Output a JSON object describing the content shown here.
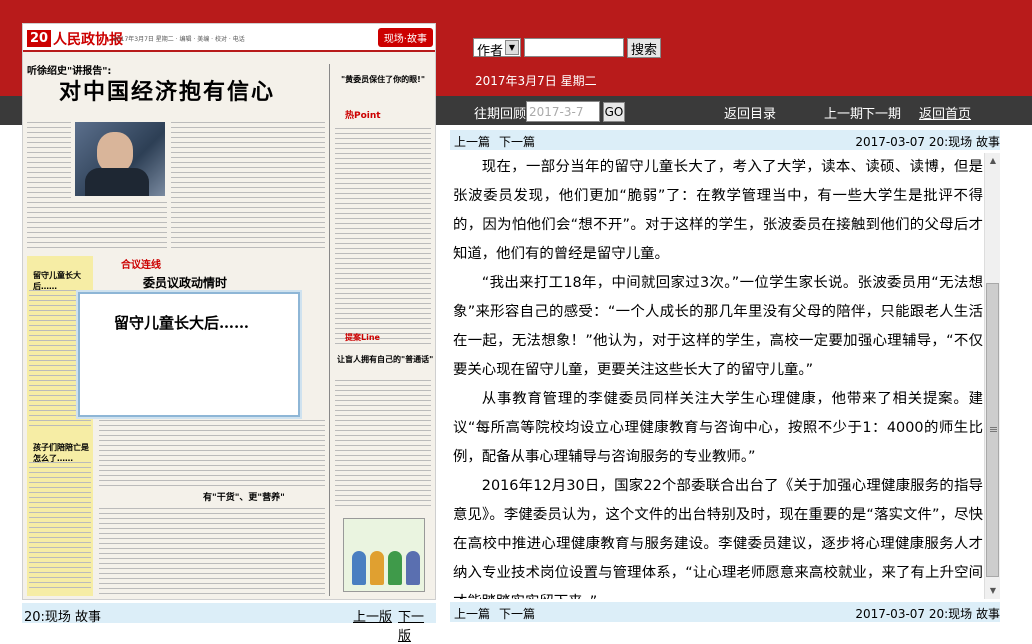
{
  "newspaper": {
    "page_number": "20",
    "masthead": "人民政协报",
    "header_small": "2017年3月7日 星期二 · 编辑 · 美编 · 校对 · 电话",
    "section_badge": "现场·故事",
    "kicker": "听徐绍史\"讲报告\":",
    "headline": "对中国经济抱有信心",
    "right_title": "\"黄委员保住了你的眼!\"",
    "right_logo": "热Point",
    "yellow_label_1": "留守儿童长大后……",
    "yellow_label_2": "孩子们陪陪亡是怎么了……",
    "heyi_label": "合议连线",
    "heyi_title": "委员议政动情时",
    "right_title_3": "让盲人拥有自己的\"普通话\"",
    "right_badge": "提案Line",
    "bottom_title": "有\"干货\"、更\"营养\""
  },
  "popup": {
    "text": "留守儿童长大后……"
  },
  "left_footer": {
    "page_label": "20:现场 故事",
    "prev_edition": "上一版",
    "next_edition": "下一版"
  },
  "search": {
    "field_selected": "作者",
    "placeholder": "",
    "button": "搜索"
  },
  "date_line": "2017年3月7日 星期二",
  "nav": {
    "back_issue_label": "往期回顾:",
    "date_value": "2017-3-7",
    "go": "GO",
    "back_to_index": "返回目录",
    "prev_issue": "上一期",
    "next_issue": "下一期",
    "home": "返回首页"
  },
  "article_nav": {
    "prev": "上一篇",
    "next": "下一篇",
    "meta": "2017-03-07 20:现场 故事"
  },
  "article": {
    "paragraphs": [
      "现在，一部分当年的留守儿童长大了，考入了大学，读本、读硕、读博，但是张波委员发现，他们更加“脆弱”了：在教学管理当中，有一些大学生是批评不得的，因为怕他们会“想不开”。对于这样的学生，张波委员在接触到他们的父母后才知道，他们有的曾经是留守儿童。",
      "“我出来打工18年，中间就回家过3次。”一位学生家长说。张波委员用“无法想象”来形容自己的感受：“一个人成长的那几年里没有父母的陪伴，只能跟老人生活在一起，无法想象！”他认为，对于这样的学生，高校一定要加强心理辅导，“不仅要关心现在留守儿童，更要关注这些长大了的留守儿童。”",
      "从事教育管理的李健委员同样关注大学生心理健康，他带来了相关提案。建议“每所高等院校均设立心理健康教育与咨询中心，按照不少于1：4000的师生比例，配备从事心理辅导与咨询服务的专业教师。”",
      "2016年12月30日，国家22个部委联合出台了《关于加强心理健康服务的指导意见》。李健委员认为，这个文件的出台特别及时，现在重要的是“落实文件”，尽快在高校中推进心理健康教育与服务建设。李健委员建议，逐步将心理健康服务人才纳入专业技术岗位设置与管理体系，“让心理老师愿意来高校就业，来了有上升空间才能踏踏实实留下来。”"
    ]
  },
  "colors": {
    "header_red": "#b81b1b",
    "nav_gray": "#3a3a3a",
    "bar_blue": "#dceef8"
  }
}
